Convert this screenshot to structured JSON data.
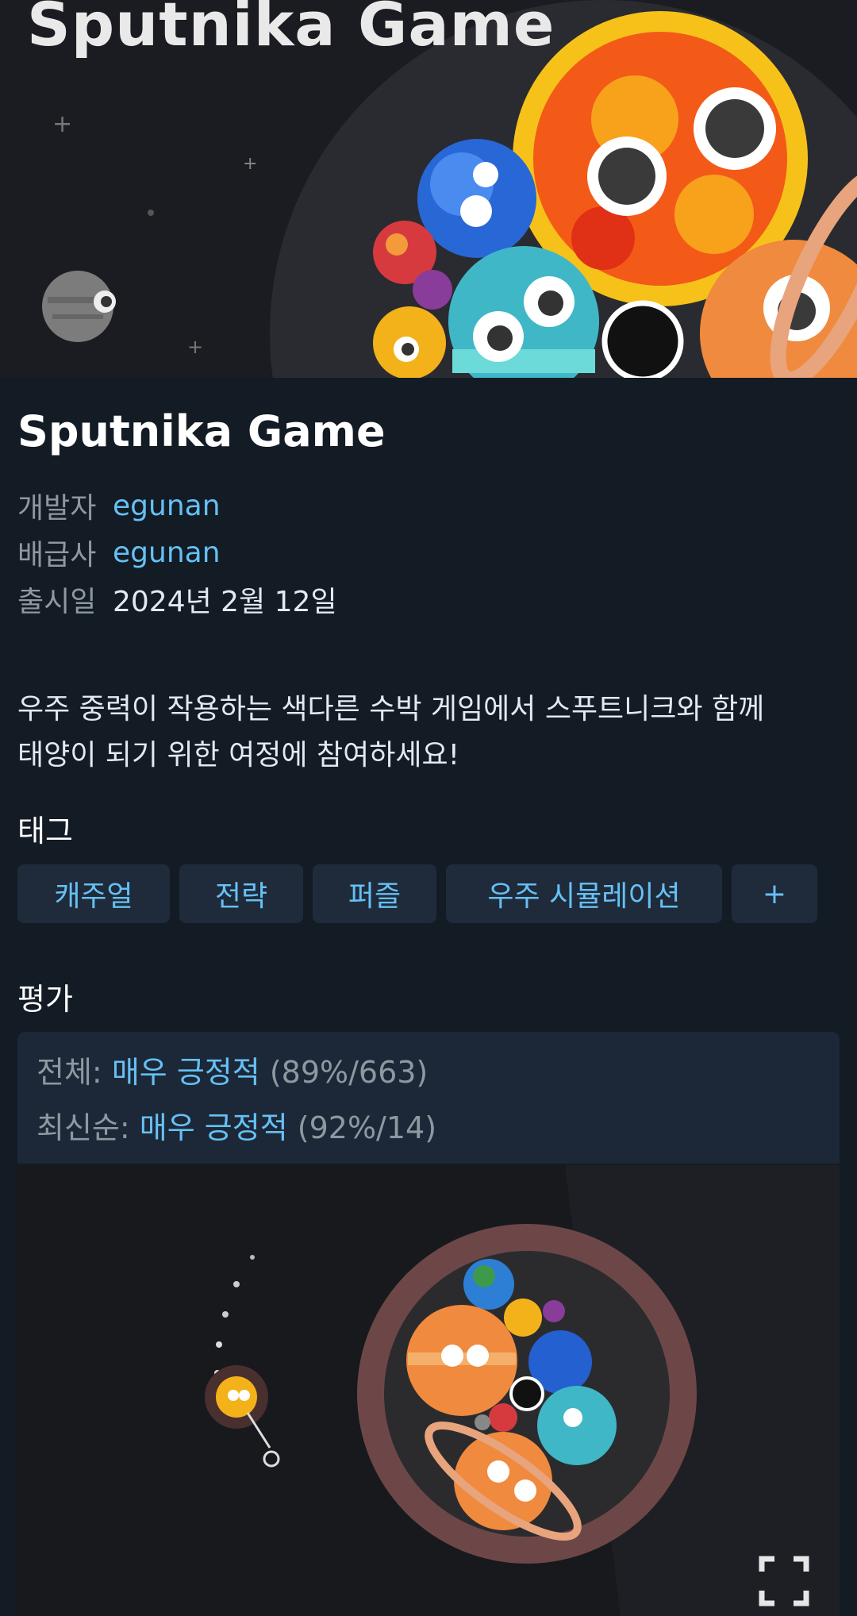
{
  "banner": {
    "title_art": "Sputnika Game"
  },
  "game": {
    "title": "Sputnika Game"
  },
  "details": {
    "developer_label": "개발자",
    "developer": "egunan",
    "publisher_label": "배급사",
    "publisher": "egunan",
    "release_label": "출시일",
    "release_date": "2024년 2월 12일"
  },
  "description": {
    "line1": "우주 중력이 작용하는 색다른 수박 게임에서 스푸트니크와 함께",
    "line2": "태양이 되기 위한 여정에 참여하세요!"
  },
  "tags": {
    "title": "태그",
    "items": [
      "캐주얼",
      "전략",
      "퍼즐",
      "우주 시뮬레이션",
      "+"
    ]
  },
  "reviews": {
    "title": "평가",
    "overall_label": "전체:",
    "overall_rating": "매우 긍정적",
    "overall_stats": "(89%/663)",
    "recent_label": "최신순:",
    "recent_rating": "매우 긍정적",
    "recent_stats": "(92%/14)"
  },
  "icons": {
    "fullscreen": "fullscreen-icon"
  },
  "colors": {
    "background": "#131b25",
    "link": "#66c0f4",
    "tag_bg": "#1f2b3a",
    "review_bg": "#1c2837"
  }
}
